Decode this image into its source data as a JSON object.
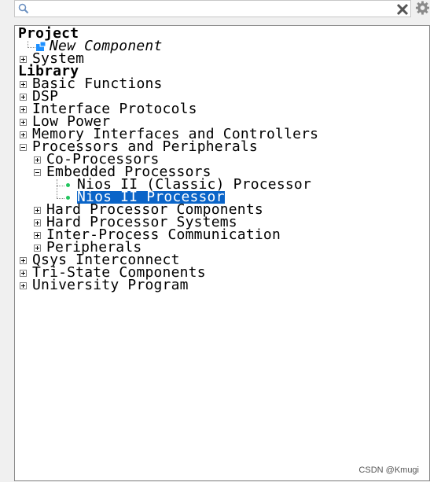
{
  "search": {
    "value": "",
    "placeholder": ""
  },
  "tree": {
    "project_header": "Project",
    "new_component": "New Component",
    "system": "System",
    "library_header": "Library",
    "items": {
      "basic_functions": "Basic Functions",
      "dsp": "DSP",
      "interface_protocols": "Interface Protocols",
      "low_power": "Low Power",
      "memory": "Memory Interfaces and Controllers",
      "processors": "Processors and Peripherals",
      "co_processors": "Co-Processors",
      "embedded_processors": "Embedded Processors",
      "nios_classic": "Nios II (Classic) Processor",
      "nios": "Nios II Processor",
      "hard_components": "Hard Processor Components",
      "hard_systems": "Hard Processor Systems",
      "inter_process": "Inter-Process Communication",
      "peripherals": "Peripherals",
      "qsys": "Qsys Interconnect",
      "tri_state": "Tri-State Components",
      "university": "University Program"
    }
  },
  "watermark": "CSDN @Kmugi",
  "colors": {
    "selection": "#0a64c8",
    "bullet": "#22c55e",
    "accent": "#1e90ff"
  }
}
